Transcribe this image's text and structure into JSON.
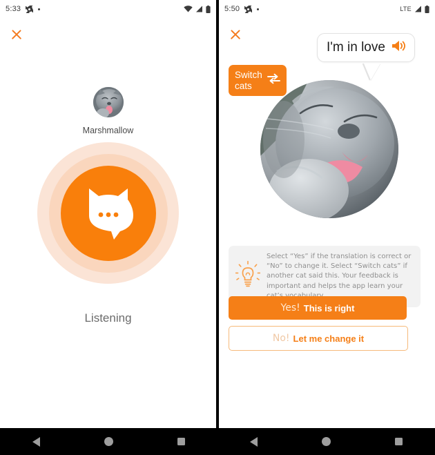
{
  "screens": [
    {
      "id": "listening",
      "statusbar": {
        "time": "5:33",
        "gear_icon": "gear-icon",
        "dot_icon": "dot-icon",
        "wifi_icon": "wifi-icon",
        "signal_icon": "signal-icon",
        "battery_icon": "battery-icon"
      },
      "close_icon": "close-icon",
      "cat_name": "Marshmallow",
      "avatar_icon": "cat-avatar",
      "mic_button_icon": "cat-speech-bubble-icon",
      "status_label": "Listening"
    },
    {
      "id": "translation-result",
      "statusbar": {
        "time": "5:50",
        "gear_icon": "gear-icon",
        "dot_icon": "dot-icon",
        "network_label": "LTE",
        "signal_icon": "signal-icon",
        "battery_icon": "battery-icon"
      },
      "close_icon": "close-icon",
      "speech_bubble": {
        "text": "I'm in love",
        "speaker_icon": "speaker-icon"
      },
      "switch_button": {
        "line1": "Switch",
        "line2": "cats",
        "icon": "swap-arrows-icon"
      },
      "photo_icon": "cat-photo",
      "tip": {
        "icon": "lightbulb-icon",
        "text": "Select “Yes” if the translation is correct or “No” to change it. Select “Switch cats” if another cat said this. Your feedback is important and helps the app learn your cat’s vocabulary."
      },
      "buttons": [
        {
          "id": "yes",
          "word": "Yes!",
          "rest": "This is right"
        },
        {
          "id": "no",
          "word": "No!",
          "rest": "Let me change it"
        }
      ]
    }
  ],
  "navbar": {
    "back_icon": "back-icon",
    "home_icon": "home-icon",
    "recents_icon": "recents-icon"
  },
  "colors": {
    "accent": "#f57f17",
    "accent_bright": "#f97f0b",
    "ring_mid": "#fad6bd",
    "ring_outer": "#fbe4d6",
    "tip_bg": "#f2f2f2"
  }
}
